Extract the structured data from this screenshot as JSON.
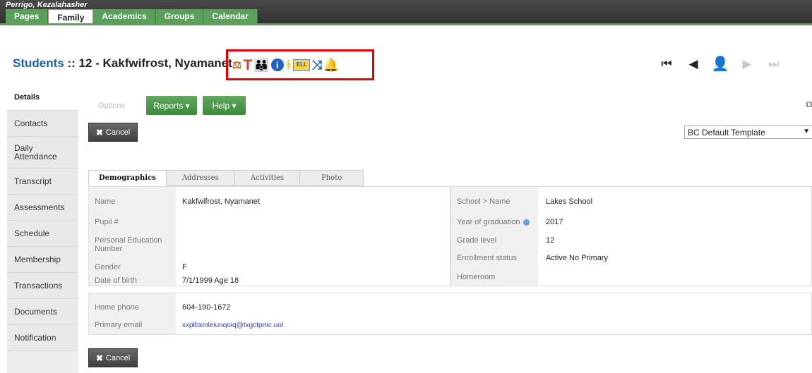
{
  "user": {
    "name": "Perrigo, Kezalahasher"
  },
  "nav_tabs": [
    {
      "label": "Pages",
      "active": false
    },
    {
      "label": "Family",
      "active": true
    },
    {
      "label": "Academics",
      "active": false
    },
    {
      "label": "Groups",
      "active": false
    },
    {
      "label": "Calendar",
      "active": false
    }
  ],
  "header": {
    "crumb": "Students",
    "separator": " :: ",
    "record": "12 - Kakfwifrost, Nyamanet",
    "alert_icons": [
      "scale-icon",
      "t-icon",
      "family-icon",
      "info-icon",
      "health-icon",
      "ell-icon",
      "shuffle-icon",
      "bell-icon"
    ],
    "ell_text": "ELL"
  },
  "record_nav": [
    "first-record-icon",
    "previous-record-icon",
    "student-photo-icon",
    "next-record-icon",
    "last-record-icon"
  ],
  "sidebar": {
    "items": [
      {
        "label": "Details",
        "active": true
      },
      {
        "label": "Contacts"
      },
      {
        "label": "Daily Attendance"
      },
      {
        "label": "Transcript"
      },
      {
        "label": "Assessments"
      },
      {
        "label": "Schedule"
      },
      {
        "label": "Membership"
      },
      {
        "label": "Transactions"
      },
      {
        "label": "Documents"
      },
      {
        "label": "Notification"
      }
    ]
  },
  "toolbar": {
    "options": "Options",
    "reports": "Reports ▾",
    "help": "Help ▾",
    "cancel": "Cancel",
    "template": "BC Default Template"
  },
  "subtabs": [
    {
      "label": "Demographics",
      "active": true
    },
    {
      "label": "Addresses"
    },
    {
      "label": "Activities"
    },
    {
      "label": "Photo"
    }
  ],
  "demographics": {
    "name_label": "Name",
    "name_value": "Kakfwifrost, Nyamanet",
    "pupil_label": "Pupil #",
    "pupil_value": "",
    "pen_label": "Personal Education Number",
    "pen_value": "",
    "gender_label": "Gender",
    "gender_value": "F",
    "dob_label": "Date of birth",
    "dob_value": "7/1/1999 Age 18",
    "school_label": "School > Name",
    "school_value": "Lakes School",
    "grad_label": "Year of graduation",
    "grad_value": "2017",
    "grade_label": "Grade level",
    "grade_value": "12",
    "enroll_label": "Enrollment status",
    "enroll_value": "Active No Primary",
    "homeroom_label": "Homeroom",
    "homeroom_value": ""
  },
  "contact": {
    "phone_label": "Home phone",
    "phone_value": "604-190-1672",
    "email_label": "Primary email",
    "email_value": "xxplbxmleiunqoiq@txgctpmc.uol"
  },
  "colors": {
    "nav_green": "#5a9f5a",
    "alert_border": "#e60000",
    "link_blue": "#1f5fa8"
  }
}
